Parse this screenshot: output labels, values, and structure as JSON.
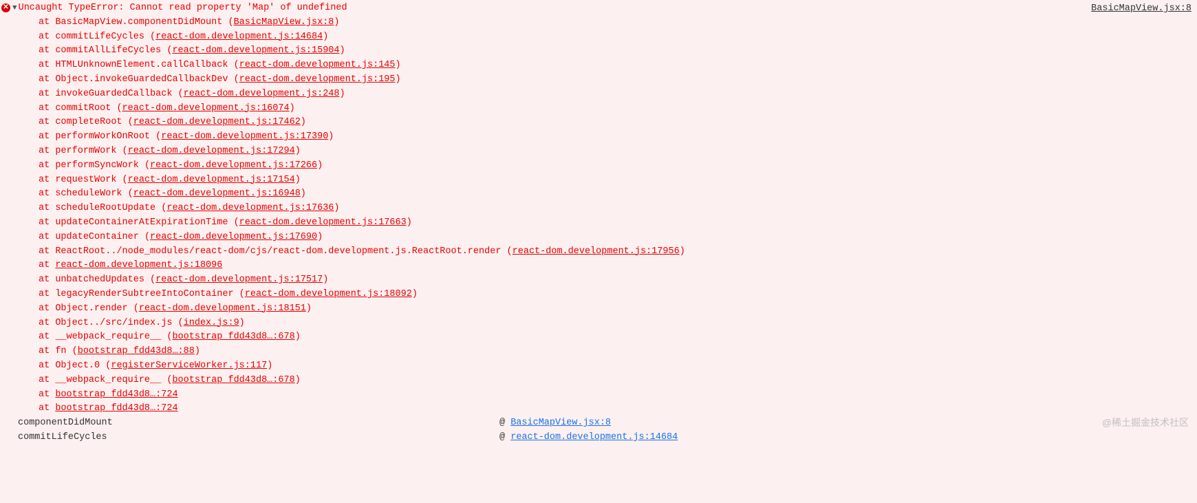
{
  "error": {
    "message": "Uncaught TypeError: Cannot read property 'Map' of undefined",
    "source_link": "BasicMapView.jsx:8"
  },
  "stack": [
    {
      "fn": "BasicMapView.componentDidMount",
      "link": "BasicMapView.jsx:8",
      "paren": true
    },
    {
      "fn": "commitLifeCycles",
      "link": "react-dom.development.js:14684",
      "paren": true
    },
    {
      "fn": "commitAllLifeCycles",
      "link": "react-dom.development.js:15904",
      "paren": true
    },
    {
      "fn": "HTMLUnknownElement.callCallback",
      "link": "react-dom.development.js:145",
      "paren": true
    },
    {
      "fn": "Object.invokeGuardedCallbackDev",
      "link": "react-dom.development.js:195",
      "paren": true
    },
    {
      "fn": "invokeGuardedCallback",
      "link": "react-dom.development.js:248",
      "paren": true
    },
    {
      "fn": "commitRoot",
      "link": "react-dom.development.js:16074",
      "paren": true
    },
    {
      "fn": "completeRoot",
      "link": "react-dom.development.js:17462",
      "paren": true
    },
    {
      "fn": "performWorkOnRoot",
      "link": "react-dom.development.js:17390",
      "paren": true
    },
    {
      "fn": "performWork",
      "link": "react-dom.development.js:17294",
      "paren": true
    },
    {
      "fn": "performSyncWork",
      "link": "react-dom.development.js:17266",
      "paren": true
    },
    {
      "fn": "requestWork",
      "link": "react-dom.development.js:17154",
      "paren": true
    },
    {
      "fn": "scheduleWork",
      "link": "react-dom.development.js:16948",
      "paren": true
    },
    {
      "fn": "scheduleRootUpdate",
      "link": "react-dom.development.js:17636",
      "paren": true
    },
    {
      "fn": "updateContainerAtExpirationTime",
      "link": "react-dom.development.js:17663",
      "paren": true
    },
    {
      "fn": "updateContainer",
      "link": "react-dom.development.js:17690",
      "paren": true
    },
    {
      "fn": "ReactRoot../node_modules/react-dom/cjs/react-dom.development.js.ReactRoot.render",
      "link": "react-dom.development.js:17956",
      "paren": true
    },
    {
      "fn": "",
      "link": "react-dom.development.js:18096",
      "paren": false
    },
    {
      "fn": "unbatchedUpdates",
      "link": "react-dom.development.js:17517",
      "paren": true
    },
    {
      "fn": "legacyRenderSubtreeIntoContainer",
      "link": "react-dom.development.js:18092",
      "paren": true
    },
    {
      "fn": "Object.render",
      "link": "react-dom.development.js:18151",
      "paren": true
    },
    {
      "fn": "Object../src/index.js",
      "link": "index.js:9",
      "paren": true
    },
    {
      "fn": "__webpack_require__",
      "link": "bootstrap fdd43d8…:678",
      "paren": true
    },
    {
      "fn": "fn",
      "link": "bootstrap fdd43d8…:88",
      "paren": true
    },
    {
      "fn": "Object.0",
      "link": "registerServiceWorker.js:117",
      "paren": true
    },
    {
      "fn": "__webpack_require__",
      "link": "bootstrap fdd43d8…:678",
      "paren": true
    },
    {
      "fn": "",
      "link": "bootstrap fdd43d8…:724",
      "paren": false
    },
    {
      "fn": "",
      "link": "bootstrap fdd43d8…:724",
      "paren": false
    }
  ],
  "secondary": [
    {
      "fn": "componentDidMount",
      "link": "BasicMapView.jsx:8",
      "blue": true
    },
    {
      "fn": "commitLifeCycles",
      "link": "react-dom.development.js:14684",
      "blue": true
    }
  ],
  "at_label": "at",
  "at_sign": "@",
  "disclosure": "▼",
  "watermark": "@稀土掘金技术社区"
}
